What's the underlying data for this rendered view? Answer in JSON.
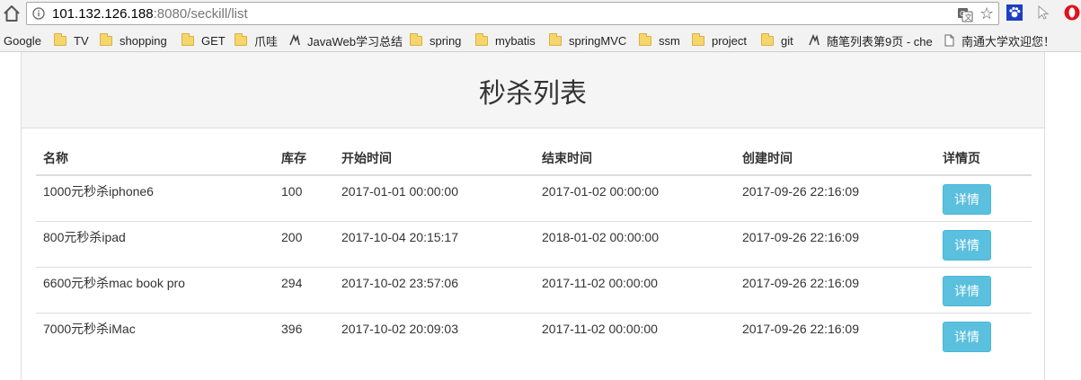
{
  "browser": {
    "url_host": "101.132.126.188",
    "url_rest": ":8080/seckill/list",
    "bookmarks": [
      {
        "label": "Google",
        "icon": "none"
      },
      {
        "label": "TV",
        "icon": "folder"
      },
      {
        "label": "shopping",
        "icon": "folder"
      },
      {
        "label": "GET",
        "icon": "folder"
      },
      {
        "label": "爪哇",
        "icon": "folder"
      },
      {
        "label": "JavaWeb学习总结",
        "icon": "site"
      },
      {
        "label": "spring",
        "icon": "folder"
      },
      {
        "label": "mybatis",
        "icon": "folder"
      },
      {
        "label": "springMVC",
        "icon": "folder"
      },
      {
        "label": "ssm",
        "icon": "folder"
      },
      {
        "label": "project",
        "icon": "folder"
      },
      {
        "label": "git",
        "icon": "folder"
      },
      {
        "label": "随笔列表第9页 - che",
        "icon": "site"
      },
      {
        "label": "南通大学欢迎您！",
        "icon": "page"
      }
    ]
  },
  "page": {
    "title": "秒杀列表",
    "table": {
      "headers": [
        "名称",
        "库存",
        "开始时间",
        "结束时间",
        "创建时间",
        "详情页"
      ],
      "rows": [
        {
          "name": "1000元秒杀iphone6",
          "stock": "100",
          "start": "2017-01-01 00:00:00",
          "end": "2017-01-02 00:00:00",
          "created": "2017-09-26 22:16:09",
          "action": "详情"
        },
        {
          "name": "800元秒杀ipad",
          "stock": "200",
          "start": "2017-10-04 20:15:17",
          "end": "2018-01-02 00:00:00",
          "created": "2017-09-26 22:16:09",
          "action": "详情"
        },
        {
          "name": "6600元秒杀mac book pro",
          "stock": "294",
          "start": "2017-10-02 23:57:06",
          "end": "2017-11-02 00:00:00",
          "created": "2017-09-26 22:16:09",
          "action": "详情"
        },
        {
          "name": "7000元秒杀iMac",
          "stock": "396",
          "start": "2017-10-02 20:09:03",
          "end": "2017-11-02 00:00:00",
          "created": "2017-09-26 22:16:09",
          "action": "详情"
        }
      ]
    }
  },
  "colors": {
    "button": "#5bc0de",
    "heading_bg": "#f5f5f5",
    "folder": "#f7d56d"
  }
}
